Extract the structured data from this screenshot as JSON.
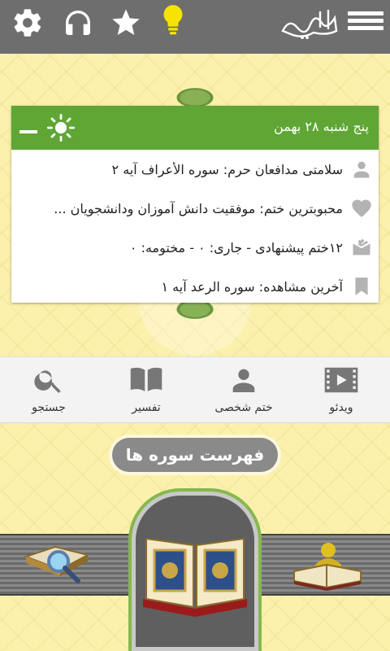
{
  "app": {
    "logo_text": "حبل المتین",
    "colors": {
      "accent": "#5fa635",
      "topbar": "#6e6e6e",
      "background": "#fbf1ad"
    }
  },
  "topbar": {
    "icons": [
      "gear-icon",
      "headphones-icon",
      "star-icon",
      "lightbulb-icon",
      "menu-icon"
    ]
  },
  "card": {
    "date": "پنج شنبه ۲۸ بهمن",
    "rows": [
      {
        "icon": "person-icon",
        "text": "سلامتی مدافعان حرم: سوره الأعراف آیه ۲"
      },
      {
        "icon": "heart-icon",
        "text": "محبوبترین ختم: موفقیت دانش آموزان ودانشجویان ..."
      },
      {
        "icon": "mail-open-icon",
        "text": "۱۲ختم پیشنهادی - جاری: ۰ - مختومه: ۰"
      },
      {
        "icon": "bookmark-icon",
        "text": "آخرین مشاهده: سوره الرعد آیه ۱"
      }
    ]
  },
  "tabs": [
    {
      "label": "جستجو",
      "icon": "search-icon"
    },
    {
      "label": "تفسیر",
      "icon": "book-icon"
    },
    {
      "label": "ختم شخصی",
      "icon": "person-icon"
    },
    {
      "label": "ویدئو",
      "icon": "video-icon"
    }
  ],
  "surah_list": {
    "label": "فهرست سوره ها"
  }
}
